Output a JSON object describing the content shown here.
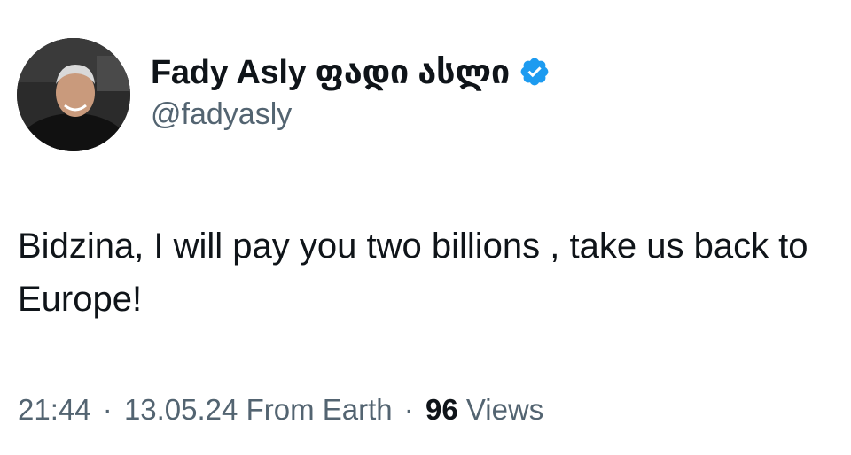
{
  "author": {
    "display_name": "Fady Asly ფადი ასლი",
    "handle": "@fadyasly",
    "verified": true,
    "verified_color": "#1d9bf0"
  },
  "tweet": {
    "text": "Bidzina, I will pay you two billions , take us back to Europe!"
  },
  "meta": {
    "time": "21:44",
    "separator": "·",
    "date": "13.05.24",
    "source": "From Earth",
    "views_count": "96",
    "views_label": "Views"
  },
  "icons": {
    "verified": "verified-badge-icon",
    "avatar": "profile-photo"
  }
}
